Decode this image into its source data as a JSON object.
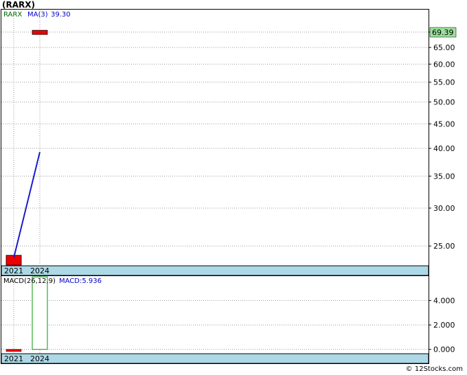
{
  "header": {
    "title": "(RARX)"
  },
  "footer": {
    "credit": "© 12Stocks.com"
  },
  "colors": {
    "candle_down": "#ee0000",
    "ma_line": "#1a1acc",
    "macd_bar": "#009900",
    "axis_band": "#add8e6",
    "last_price_badge": "#9be09b",
    "ticker_legend": "#006600",
    "ma_legend": "#0000cc"
  },
  "chart_data": [
    {
      "type": "candlestick",
      "legend": {
        "ticker": "RARX",
        "ma_label": "MA(3)",
        "ma_value": "39.30"
      },
      "x_ticks": [
        "2021",
        "2024"
      ],
      "y_ticks": [
        "25.00",
        "30.00",
        "35.00",
        "40.00",
        "45.00",
        "50.00",
        "55.00",
        "60.00",
        "65.00",
        "70.00"
      ],
      "y_tick_values": [
        25,
        30,
        35,
        40,
        45,
        50,
        55,
        60,
        65,
        70
      ],
      "ylim": [
        22.8,
        78
      ],
      "scale": "log",
      "last_price": "69.39",
      "candles": [
        {
          "x": "2021",
          "open": 23.9,
          "close": 22.8,
          "color": "red"
        },
        {
          "x": "2024",
          "open": 70.6,
          "close": 69.39,
          "color": "red"
        }
      ],
      "ma_series": [
        {
          "x": "2021",
          "value": 23.6
        },
        {
          "x": "2024",
          "value": 39.3
        }
      ]
    },
    {
      "type": "bar",
      "legend": {
        "label": "MACD(26,12,9)",
        "value_label": "MACD:5.936"
      },
      "x_ticks": [
        "2021",
        "2024"
      ],
      "y_ticks": [
        "0.000",
        "2.000",
        "4.000"
      ],
      "y_tick_values": [
        0,
        2,
        4
      ],
      "ylim": [
        -0.3,
        6.0
      ],
      "bars": [
        {
          "x": "2021",
          "value": -0.15,
          "color": "red"
        },
        {
          "x": "2024",
          "value": 5.936,
          "color": "green"
        }
      ]
    }
  ]
}
